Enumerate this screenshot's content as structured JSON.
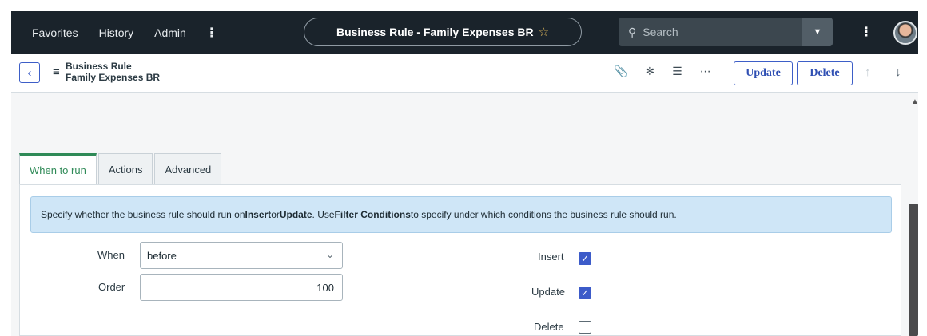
{
  "topbar": {
    "nav": [
      "Favorites",
      "History",
      "Admin"
    ],
    "more_glyph": "⋮",
    "title": "Business Rule - Family Expenses BR",
    "star": "☆",
    "search_placeholder": "Search",
    "user_more_glyph": "⋮"
  },
  "header": {
    "back_glyph": "‹",
    "menu_glyph": "≡",
    "record_type": "Business Rule",
    "record_name": "Family Expenses BR",
    "icons": [
      "paperclip-icon",
      "activity-icon",
      "settings-sliders-icon",
      "more-horizontal-icon"
    ],
    "update_label": "Update",
    "delete_label": "Delete",
    "up_glyph": "↑",
    "down_glyph": "↓"
  },
  "tabs": [
    "When to run",
    "Actions",
    "Advanced"
  ],
  "info": {
    "text_1": "Specify whether the business rule should run on ",
    "insert": "Insert",
    "or": " or ",
    "update": "Update",
    "use": ". Use ",
    "filter": "Filter Conditions",
    "text_2": " to specify under which conditions the business rule should run."
  },
  "form": {
    "when_label": "When",
    "when_value": "before",
    "order_label": "Order",
    "order_value": "100",
    "insert_label": "Insert",
    "insert_checked": true,
    "update_label": "Update",
    "update_checked": true,
    "delete_label": "Delete",
    "delete_checked": false
  },
  "colors": {
    "topbar": "#1a232b",
    "accent": "#3d5ec7",
    "tab_active": "#2f8a57",
    "info_bg": "#cfe6f7"
  }
}
